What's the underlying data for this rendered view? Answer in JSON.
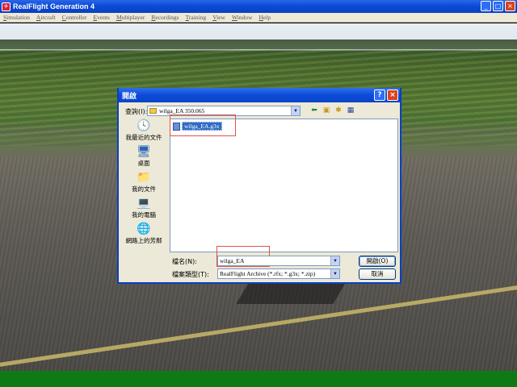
{
  "window": {
    "title": "RealFlight Generation 4",
    "controls": {
      "minimize": "_",
      "maximize": "□",
      "close": "×"
    }
  },
  "menu": [
    {
      "first": "S",
      "rest": "imulation"
    },
    {
      "first": "A",
      "rest": "ircraft"
    },
    {
      "first": "C",
      "rest": "ontroller"
    },
    {
      "first": "E",
      "rest": "vents"
    },
    {
      "first": "M",
      "rest": "ultiplayer"
    },
    {
      "first": "R",
      "rest": "ecordings"
    },
    {
      "first": "T",
      "rest": "raining"
    },
    {
      "first": "V",
      "rest": "iew"
    },
    {
      "first": "W",
      "rest": "indow"
    },
    {
      "first": "H",
      "rest": "elp"
    }
  ],
  "dialog": {
    "title": "開啟",
    "help": "?",
    "close": "×",
    "look_in_label": "查詢(I):",
    "look_in_value": "wilga_EA 350.065",
    "places": [
      {
        "label": "我最近的文件",
        "icon": "recent-docs-icon"
      },
      {
        "label": "桌面",
        "icon": "desktop-icon"
      },
      {
        "label": "我的文件",
        "icon": "my-documents-icon"
      },
      {
        "label": "我的電腦",
        "icon": "my-computer-icon"
      },
      {
        "label": "網路上的芳鄰",
        "icon": "network-icon"
      }
    ],
    "files": [
      "wilga_EA.g3x"
    ],
    "filename_label": "檔名(N):",
    "filename_value": "wilga_EA",
    "filetype_label": "檔案類型(T):",
    "filetype_value": "RealFlight Archive (*.rfx; *.g3x; *.zip)",
    "open_button": "開啟(O)",
    "cancel_button": "取消"
  }
}
